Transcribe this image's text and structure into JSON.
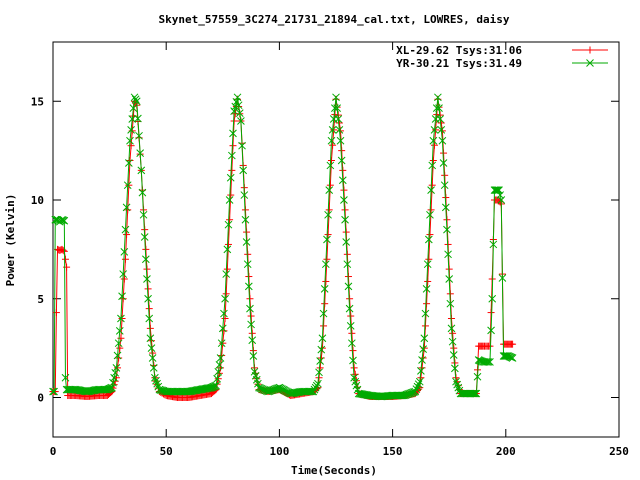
{
  "chart_data": {
    "type": "line",
    "title": "Skynet_57559_3C274_21731_21894_cal.txt, LOWRES, daisy",
    "xlabel": "Time(Seconds)",
    "ylabel": "Power (Kelvin)",
    "xlim": [
      0,
      250
    ],
    "ylim": [
      -2,
      18
    ],
    "xticks": [
      0,
      50,
      100,
      150,
      200,
      250
    ],
    "yticks": [
      0,
      5,
      10,
      15
    ],
    "grid": false,
    "legend_position": "top-right",
    "series": [
      {
        "name": "XL-29.62 Tsys:31.06",
        "color": "#ff0000",
        "marker": "plus",
        "points": [
          [
            0,
            0.3
          ],
          [
            1,
            0.3
          ],
          [
            1.5,
            4.3
          ],
          [
            2,
            7.5
          ],
          [
            3,
            7.45
          ],
          [
            4,
            7.5
          ],
          [
            5,
            7.4
          ],
          [
            6,
            6.6
          ],
          [
            6.5,
            0.1
          ],
          [
            10,
            0.1
          ],
          [
            15,
            0.05
          ],
          [
            20,
            0.1
          ],
          [
            24,
            0.1
          ],
          [
            26,
            0.3
          ],
          [
            28,
            1.0
          ],
          [
            30,
            3.0
          ],
          [
            32,
            7.0
          ],
          [
            34,
            12.0
          ],
          [
            36,
            15.0
          ],
          [
            37,
            14.8
          ],
          [
            39,
            11.5
          ],
          [
            41,
            7.5
          ],
          [
            43,
            3.5
          ],
          [
            45,
            1.0
          ],
          [
            47,
            0.3
          ],
          [
            50,
            0.1
          ],
          [
            55,
            0.0
          ],
          [
            60,
            0.0
          ],
          [
            65,
            0.1
          ],
          [
            70,
            0.2
          ],
          [
            72,
            0.4
          ],
          [
            74,
            1.5
          ],
          [
            76,
            4.0
          ],
          [
            78,
            9.0
          ],
          [
            80,
            14.0
          ],
          [
            81.5,
            15.1
          ],
          [
            83,
            14.0
          ],
          [
            85,
            9.5
          ],
          [
            87,
            5.0
          ],
          [
            89,
            1.5
          ],
          [
            91,
            0.4
          ],
          [
            95,
            0.3
          ],
          [
            100,
            0.4
          ],
          [
            105,
            0.1
          ],
          [
            110,
            0.2
          ],
          [
            115,
            0.3
          ],
          [
            117,
            0.5
          ],
          [
            119,
            2.5
          ],
          [
            121,
            7.0
          ],
          [
            123,
            12.0
          ],
          [
            125,
            15.1
          ],
          [
            127,
            13.5
          ],
          [
            129,
            9.5
          ],
          [
            131,
            5.0
          ],
          [
            133,
            1.5
          ],
          [
            135,
            0.2
          ],
          [
            140,
            0.05
          ],
          [
            145,
            0.05
          ],
          [
            150,
            0.05
          ],
          [
            155,
            0.1
          ],
          [
            160,
            0.2
          ],
          [
            162,
            0.5
          ],
          [
            164,
            2.5
          ],
          [
            166,
            7.0
          ],
          [
            168,
            12.0
          ],
          [
            170,
            15.1
          ],
          [
            172,
            13.5
          ],
          [
            174,
            9.0
          ],
          [
            176,
            4.0
          ],
          [
            178,
            1.0
          ],
          [
            180,
            0.2
          ],
          [
            185,
            0.2
          ],
          [
            187,
            0.2
          ],
          [
            188,
            2.6
          ],
          [
            190,
            2.6
          ],
          [
            193,
            2.6
          ],
          [
            194,
            6.0
          ],
          [
            195,
            10.0
          ],
          [
            197,
            10.0
          ],
          [
            198,
            9.8
          ],
          [
            199,
            2.7
          ],
          [
            201,
            2.7
          ],
          [
            203,
            2.7
          ]
        ]
      },
      {
        "name": "YR-30.21 Tsys:31.49",
        "color": "#00aa00",
        "marker": "cross",
        "points": [
          [
            0,
            0.3
          ],
          [
            0.5,
            0.3
          ],
          [
            1,
            9.0
          ],
          [
            2,
            9.0
          ],
          [
            3,
            8.9
          ],
          [
            4,
            9.0
          ],
          [
            5,
            8.95
          ],
          [
            5.5,
            1.0
          ],
          [
            6,
            0.4
          ],
          [
            10,
            0.4
          ],
          [
            15,
            0.3
          ],
          [
            20,
            0.4
          ],
          [
            24,
            0.4
          ],
          [
            26,
            0.5
          ],
          [
            28,
            1.5
          ],
          [
            30,
            4.0
          ],
          [
            32,
            8.5
          ],
          [
            34,
            13.0
          ],
          [
            36,
            15.2
          ],
          [
            37,
            15.0
          ],
          [
            39,
            11.5
          ],
          [
            41,
            7.0
          ],
          [
            43,
            3.0
          ],
          [
            45,
            1.0
          ],
          [
            47,
            0.4
          ],
          [
            50,
            0.3
          ],
          [
            55,
            0.3
          ],
          [
            60,
            0.3
          ],
          [
            65,
            0.4
          ],
          [
            70,
            0.5
          ],
          [
            72,
            0.6
          ],
          [
            74,
            2.0
          ],
          [
            76,
            5.0
          ],
          [
            78,
            10.0
          ],
          [
            80,
            14.5
          ],
          [
            81.5,
            15.2
          ],
          [
            83,
            14.0
          ],
          [
            85,
            9.0
          ],
          [
            87,
            4.5
          ],
          [
            89,
            1.3
          ],
          [
            91,
            0.5
          ],
          [
            95,
            0.3
          ],
          [
            100,
            0.5
          ],
          [
            105,
            0.2
          ],
          [
            110,
            0.3
          ],
          [
            115,
            0.3
          ],
          [
            117,
            0.7
          ],
          [
            119,
            3.0
          ],
          [
            121,
            8.0
          ],
          [
            123,
            13.0
          ],
          [
            125,
            15.2
          ],
          [
            127,
            13.0
          ],
          [
            129,
            9.0
          ],
          [
            131,
            4.5
          ],
          [
            133,
            1.0
          ],
          [
            135,
            0.2
          ],
          [
            140,
            0.1
          ],
          [
            145,
            0.05
          ],
          [
            150,
            0.1
          ],
          [
            155,
            0.1
          ],
          [
            160,
            0.3
          ],
          [
            162,
            0.8
          ],
          [
            164,
            3.0
          ],
          [
            166,
            8.0
          ],
          [
            168,
            13.0
          ],
          [
            170,
            15.2
          ],
          [
            172,
            13.0
          ],
          [
            174,
            8.5
          ],
          [
            176,
            3.5
          ],
          [
            178,
            0.8
          ],
          [
            180,
            0.2
          ],
          [
            185,
            0.2
          ],
          [
            187,
            0.2
          ],
          [
            188,
            1.9
          ],
          [
            190,
            1.8
          ],
          [
            193,
            1.8
          ],
          [
            194,
            5.0
          ],
          [
            195,
            10.5
          ],
          [
            197,
            10.5
          ],
          [
            198,
            10.0
          ],
          [
            199,
            2.1
          ],
          [
            201,
            2.1
          ],
          [
            203,
            2.0
          ]
        ]
      }
    ]
  }
}
